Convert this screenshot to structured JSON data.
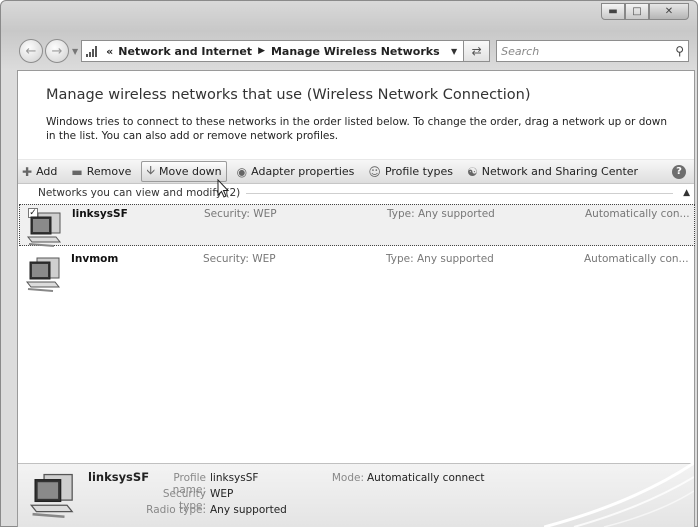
{
  "window": {
    "controls": [
      "minimize",
      "maximize",
      "close"
    ]
  },
  "nav": {
    "path_prefix": "«",
    "crumbs": [
      "Network and Internet",
      "Manage Wireless Networks"
    ],
    "search_placeholder": "Search"
  },
  "main": {
    "heading": "Manage wireless networks that use (Wireless Network Connection)",
    "intro": "Windows tries to connect to these networks in the order listed below. To change the order, drag a network up or down in the list. You can also add or remove network profiles."
  },
  "toolbar": {
    "add": "Add",
    "remove": "Remove",
    "move_down": "Move down",
    "adapter": "Adapter properties",
    "profile_types": "Profile types",
    "sharing_center": "Network and Sharing Center"
  },
  "list": {
    "group_header": "Networks you can view and modify (2)",
    "networks": [
      {
        "name": "linksysSF",
        "security": "Security: WEP",
        "type": "Type: Any supported",
        "mode": "Automatically con...",
        "selected": true
      },
      {
        "name": "Invmom",
        "security": "Security: WEP",
        "type": "Type: Any supported",
        "mode": "Automatically con...",
        "selected": false
      }
    ]
  },
  "details": {
    "name": "linksysSF",
    "profile_name_label": "Profile name:",
    "profile_name": "linksysSF",
    "security_type_label": "Security type:",
    "security_type": "WEP",
    "radio_type_label": "Radio type:",
    "radio_type": "Any supported",
    "mode_label": "Mode:",
    "mode": "Automatically connect"
  }
}
